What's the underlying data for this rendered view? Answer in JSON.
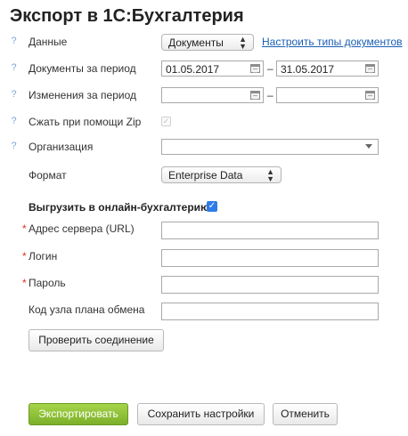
{
  "title": "Экспорт в 1С:Бухгалтерия",
  "help_glyph": "?",
  "rows": {
    "data": {
      "label": "Данные",
      "select_value": "Документы",
      "link": "Настроить типы документов"
    },
    "doc_period": {
      "label": "Документы за период",
      "from": "01.05.2017",
      "to": "31.05.2017"
    },
    "changes_period": {
      "label": "Изменения за период",
      "from": "",
      "to": ""
    },
    "zip": {
      "label": "Сжать при помощи Zip"
    },
    "org": {
      "label": "Организация",
      "value": ""
    },
    "format": {
      "label": "Формат",
      "select_value": "Enterprise Data"
    }
  },
  "dash": "–",
  "online": {
    "label": "Выгрузить в онлайн-бухгалтерию",
    "checked": true,
    "required_mark": "*",
    "server": {
      "label": "Адрес сервера (URL)",
      "value": ""
    },
    "login": {
      "label": "Логин",
      "value": ""
    },
    "password": {
      "label": "Пароль",
      "value": ""
    },
    "node": {
      "label": "Код узла плана обмена",
      "value": ""
    },
    "check_button": "Проверить соединение"
  },
  "buttons": {
    "export": "Экспортировать",
    "save": "Сохранить настройки",
    "cancel": "Отменить"
  },
  "colors": {
    "accent": "#2e7ce6",
    "primary_button": "#8fc23a",
    "link": "#1a5fb4",
    "required": "#d32f2f"
  }
}
